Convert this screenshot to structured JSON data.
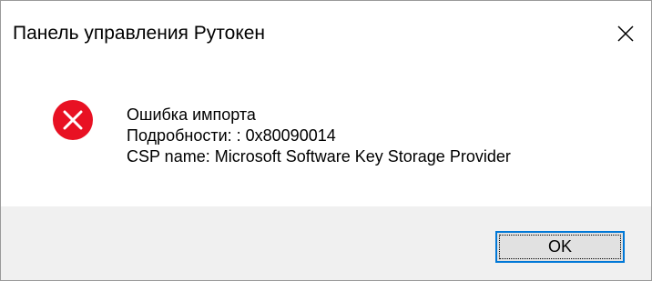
{
  "window": {
    "title": "Панель управления Рутокен",
    "close_icon": "close-icon"
  },
  "message": {
    "icon": "error-icon",
    "icon_color": "#e81123",
    "line1": "Ошибка импорта",
    "line2": "Подробности: : 0x80090014",
    "line3": "CSP name: Microsoft Software Key Storage Provider"
  },
  "buttons": {
    "ok_label": "OK"
  },
  "colors": {
    "footer_background": "#f0f0f0",
    "button_focus_border": "#0078d7"
  }
}
